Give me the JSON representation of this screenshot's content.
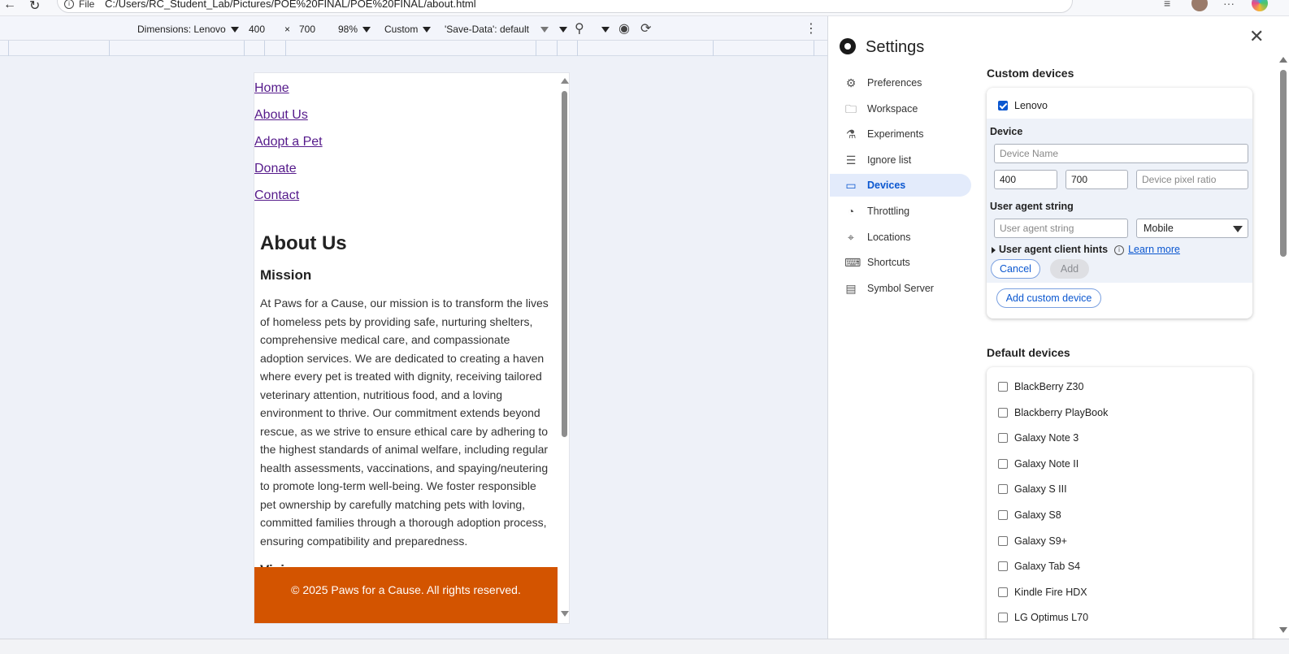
{
  "browser": {
    "scheme": "File",
    "url": "C:/Users/RC_Student_Lab/Pictures/POE%20FINAL/POE%20FINAL/about.html"
  },
  "device_toolbar": {
    "dimensions_label": "Dimensions: Lenovo",
    "width": "400",
    "times": "×",
    "height": "700",
    "zoom": "98%",
    "throttle": "Custom",
    "save_data": "'Save-Data': default"
  },
  "page": {
    "nav": [
      "Home",
      "About Us",
      "Adopt a Pet",
      "Donate",
      "Contact"
    ],
    "heading": "About Us",
    "mission_heading": "Mission",
    "mission_text": "At Paws for a Cause, our mission is to transform the lives of homeless pets by providing safe, nurturing shelters, comprehensive medical care, and compassionate adoption services. We are dedicated to creating a haven where every pet is treated with dignity, receiving tailored veterinary attention, nutritious food, and a loving environment to thrive. Our commitment extends beyond rescue, as we strive to ensure ethical care by adhering to the highest standards of animal welfare, including regular health assessments, vaccinations, and spaying/neutering to promote long-term well-being. We foster responsible pet ownership by carefully matching pets with loving, committed families through a thorough adoption process, ensuring compatibility and preparedness.",
    "next_heading_partial": "Vision",
    "footer": "© 2025 Paws for a Cause. All rights reserved.",
    "footer_color": "#d35400"
  },
  "settings": {
    "title": "Settings",
    "sidebar": [
      {
        "label": "Preferences",
        "icon": "gear-icon"
      },
      {
        "label": "Workspace",
        "icon": "folder-icon"
      },
      {
        "label": "Experiments",
        "icon": "flask-icon"
      },
      {
        "label": "Ignore list",
        "icon": "ignore-list-icon"
      },
      {
        "label": "Devices",
        "icon": "devices-icon",
        "active": true
      },
      {
        "label": "Throttling",
        "icon": "gauge-icon"
      },
      {
        "label": "Locations",
        "icon": "location-pin-icon"
      },
      {
        "label": "Shortcuts",
        "icon": "keyboard-icon"
      },
      {
        "label": "Symbol Server",
        "icon": "symbol-server-icon"
      }
    ],
    "custom_devices": {
      "title": "Custom devices",
      "device_checked": "Lenovo",
      "device_label": "Device",
      "device_name_placeholder": "Device Name",
      "width_value": "400",
      "height_value": "700",
      "pixel_ratio_placeholder": "Device pixel ratio",
      "ua_label": "User agent string",
      "ua_placeholder": "User agent string",
      "ua_type": "Mobile",
      "client_hints": "User agent client hints",
      "learn_more": "Learn more",
      "cancel": "Cancel",
      "add": "Add",
      "add_custom": "Add custom device"
    },
    "default_devices": {
      "title": "Default devices",
      "items": [
        "BlackBerry Z30",
        "Blackberry PlayBook",
        "Galaxy Note 3",
        "Galaxy Note II",
        "Galaxy S III",
        "Galaxy S8",
        "Galaxy S9+",
        "Galaxy Tab S4",
        "Kindle Fire HDX",
        "LG Optimus L70"
      ]
    },
    "accent_color": "#0b57d0"
  }
}
